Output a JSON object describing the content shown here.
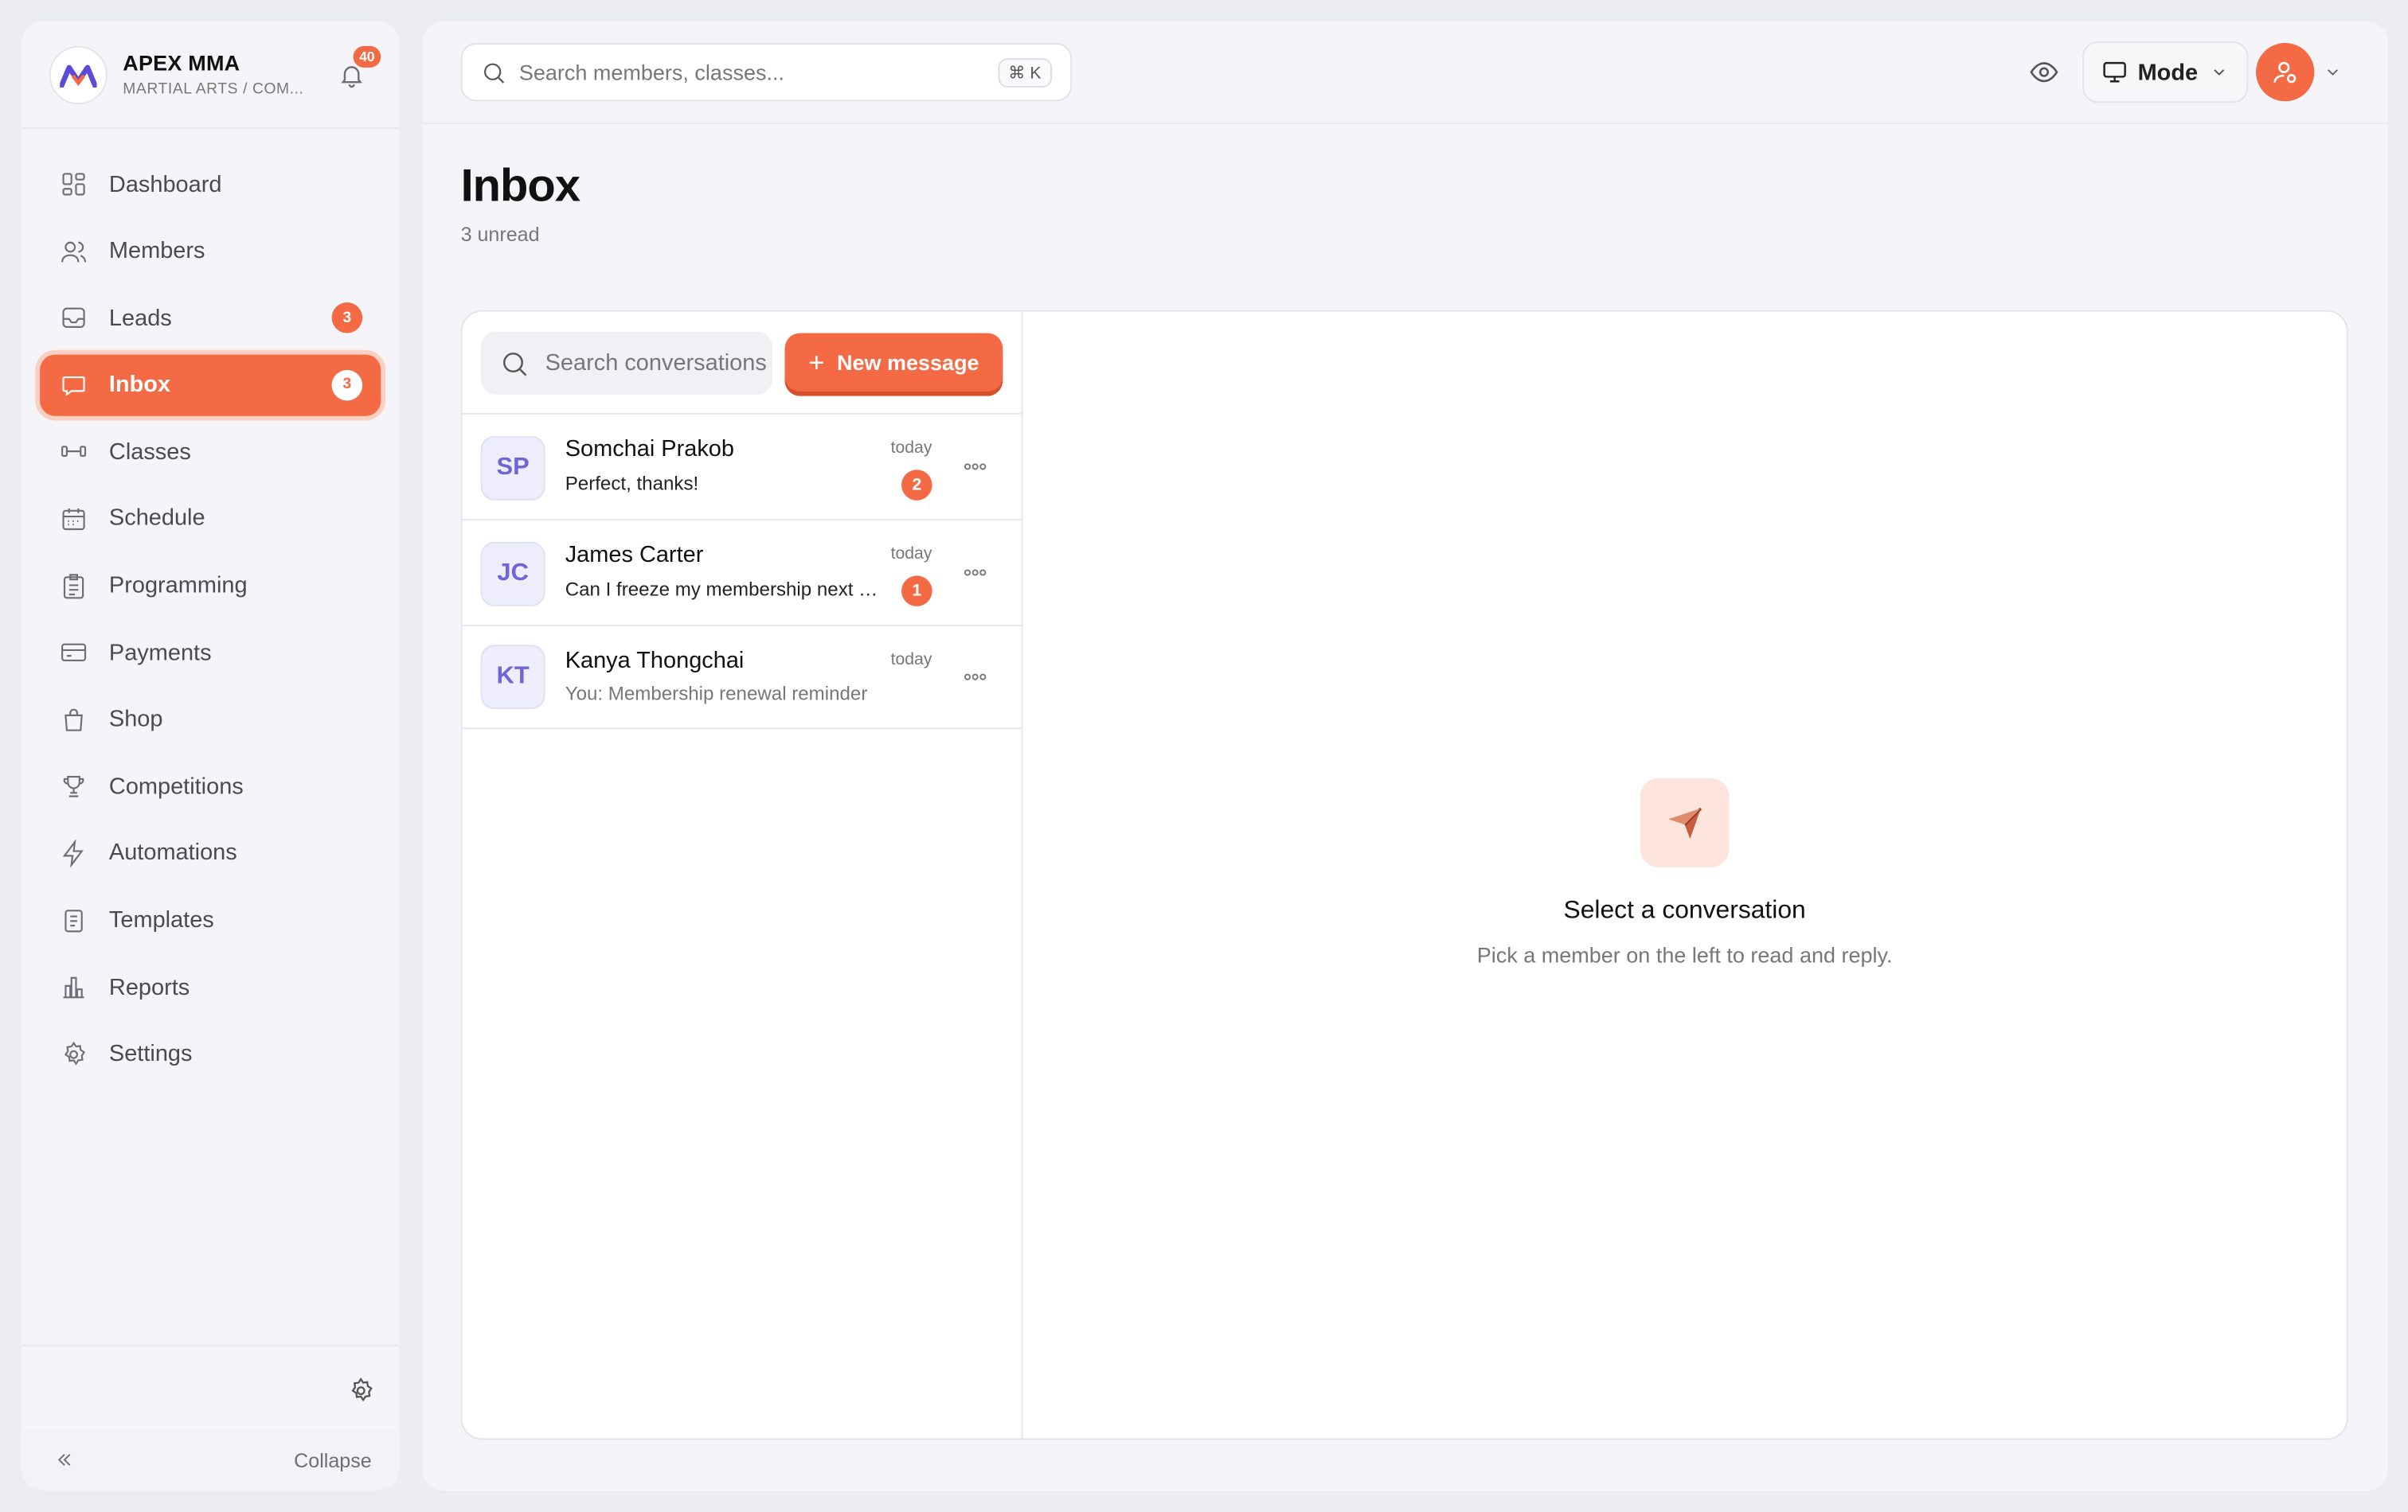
{
  "brand": {
    "name": "APEX MMA",
    "subtitle": "MARTIAL ARTS / COM...",
    "notifications": "40"
  },
  "sidebar": {
    "items": [
      {
        "label": "Dashboard",
        "icon": "dashboard-icon"
      },
      {
        "label": "Members",
        "icon": "members-icon"
      },
      {
        "label": "Leads",
        "icon": "leads-icon",
        "badge": "3"
      },
      {
        "label": "Inbox",
        "icon": "inbox-icon",
        "badge": "3",
        "active": true
      },
      {
        "label": "Classes",
        "icon": "dumbbell-icon"
      },
      {
        "label": "Schedule",
        "icon": "calendar-icon"
      },
      {
        "label": "Programming",
        "icon": "clipboard-icon"
      },
      {
        "label": "Payments",
        "icon": "card-icon"
      },
      {
        "label": "Shop",
        "icon": "bag-icon"
      },
      {
        "label": "Competitions",
        "icon": "trophy-icon"
      },
      {
        "label": "Automations",
        "icon": "bolt-icon"
      },
      {
        "label": "Templates",
        "icon": "document-icon"
      },
      {
        "label": "Reports",
        "icon": "chart-icon"
      },
      {
        "label": "Settings",
        "icon": "gear-icon"
      }
    ],
    "collapse_label": "Collapse"
  },
  "topbar": {
    "search_placeholder": "Search members, classes...",
    "shortcut": "⌘ K",
    "mode_label": "Mode"
  },
  "page": {
    "title": "Inbox",
    "subtitle": "3 unread"
  },
  "inbox": {
    "search_placeholder": "Search conversations",
    "new_message_label": "New message",
    "conversations": [
      {
        "initials": "SP",
        "name": "Somchai Prakob",
        "preview": "Perfect, thanks!",
        "time": "today",
        "unread": "2"
      },
      {
        "initials": "JC",
        "name": "James Carter",
        "preview": "Can I freeze my membership next month?",
        "time": "today",
        "unread": "1"
      },
      {
        "initials": "KT",
        "name": "Kanya Thongchai",
        "preview": "You: Membership renewal reminder",
        "time": "today",
        "unread": ""
      }
    ],
    "empty_title": "Select a conversation",
    "empty_subtitle": "Pick a member on the left to read and reply."
  },
  "colors": {
    "accent": "#F36A45",
    "avatar_bg": "#EEEDFB",
    "avatar_text": "#6F64D8"
  }
}
